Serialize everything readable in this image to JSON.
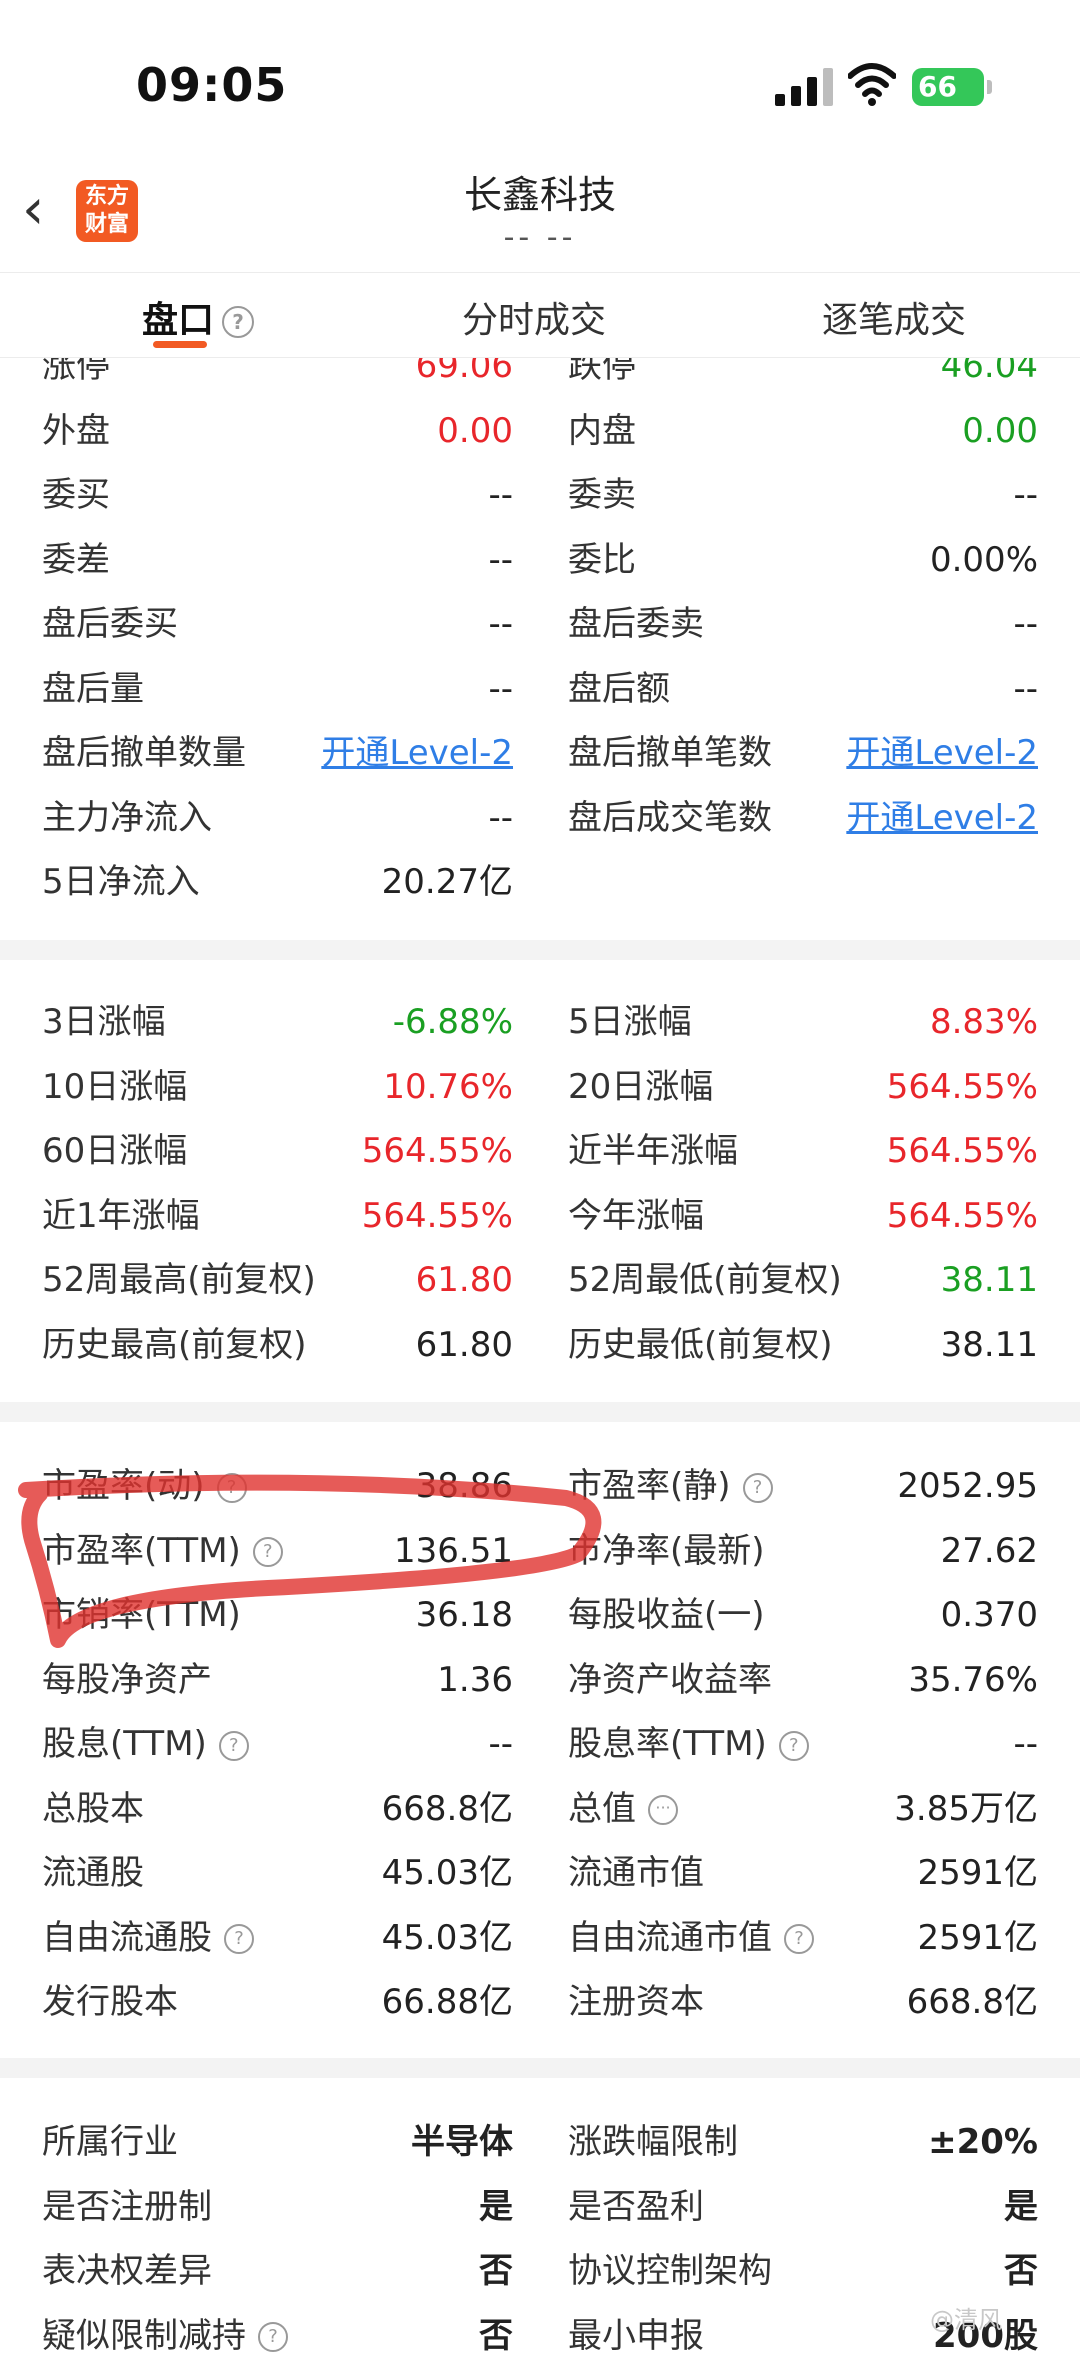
{
  "status_bar": {
    "time": "09:05",
    "battery": "66"
  },
  "header": {
    "title": "长鑫科技",
    "subtitle": "-- --",
    "logo_line1": "东方",
    "logo_line2": "财富"
  },
  "tabs": [
    {
      "label": "盘口",
      "active": true
    },
    {
      "label": "分时成交"
    },
    {
      "label": "逐笔成交"
    }
  ],
  "section1": [
    {
      "l_label": "涨停",
      "l_value": "69.06",
      "l_color": "red",
      "r_label": "跌停",
      "r_value": "46.04",
      "r_color": "green"
    },
    {
      "l_label": "外盘",
      "l_value": "0.00",
      "l_color": "red",
      "r_label": "内盘",
      "r_value": "0.00",
      "r_color": "green"
    },
    {
      "l_label": "委买",
      "l_value": "--",
      "r_label": "委卖",
      "r_value": "--"
    },
    {
      "l_label": "委差",
      "l_value": "--",
      "r_label": "委比",
      "r_value": "0.00%"
    },
    {
      "l_label": "盘后委买",
      "l_value": "--",
      "r_label": "盘后委卖",
      "r_value": "--"
    },
    {
      "l_label": "盘后量",
      "l_value": "--",
      "r_label": "盘后额",
      "r_value": "--"
    },
    {
      "l_label": "盘后撤单数量",
      "l_value": "开通Level-2",
      "l_color": "blue",
      "r_label": "盘后撤单笔数",
      "r_value": "开通Level-2",
      "r_color": "blue"
    },
    {
      "l_label": "主力净流入",
      "l_value": "--",
      "r_label": "盘后成交笔数",
      "r_value": "开通Level-2",
      "r_color": "blue"
    },
    {
      "l_label": "5日净流入",
      "l_value": "20.27亿"
    }
  ],
  "section2": [
    {
      "l_label": "3日涨幅",
      "l_value": "-6.88%",
      "l_color": "green",
      "r_label": "5日涨幅",
      "r_value": "8.83%",
      "r_color": "red"
    },
    {
      "l_label": "10日涨幅",
      "l_value": "10.76%",
      "l_color": "red",
      "r_label": "20日涨幅",
      "r_value": "564.55%",
      "r_color": "red"
    },
    {
      "l_label": "60日涨幅",
      "l_value": "564.55%",
      "l_color": "red",
      "r_label": "近半年涨幅",
      "r_value": "564.55%",
      "r_color": "red"
    },
    {
      "l_label": "近1年涨幅",
      "l_value": "564.55%",
      "l_color": "red",
      "r_label": "今年涨幅",
      "r_value": "564.55%",
      "r_color": "red"
    },
    {
      "l_label": "52周最高(前复权)",
      "l_value": "61.80",
      "l_color": "red",
      "r_label": "52周最低(前复权)",
      "r_value": "38.11",
      "r_color": "green"
    },
    {
      "l_label": "历史最高(前复权)",
      "l_value": "61.80",
      "r_label": "历史最低(前复权)",
      "r_value": "38.11"
    }
  ],
  "section3": [
    {
      "l_label": "市盈率(动)",
      "l_help": true,
      "l_value": "38.86",
      "r_label": "市盈率(静)",
      "r_help": true,
      "r_value": "2052.95"
    },
    {
      "l_label": "市盈率(TTM)",
      "l_help": true,
      "l_value": "136.51",
      "r_label": "市净率(最新)",
      "r_value": "27.62"
    },
    {
      "l_label": "市销率(TTM)",
      "l_value": "36.18",
      "r_label": "每股收益(一)",
      "r_value": "0.370"
    },
    {
      "l_label": "每股净资产",
      "l_value": "1.36",
      "r_label": "净资产收益率",
      "r_value": "35.76%"
    },
    {
      "l_label": "股息(TTM)",
      "l_help": true,
      "l_value": "--",
      "r_label": "股息率(TTM)",
      "r_help": true,
      "r_value": "--"
    },
    {
      "l_label": "总股本",
      "l_value": "668.8亿",
      "r_label": "总值",
      "r_dots": true,
      "r_value": "3.85万亿"
    },
    {
      "l_label": "流通股",
      "l_value": "45.03亿",
      "r_label": "流通市值",
      "r_value": "2591亿"
    },
    {
      "l_label": "自由流通股",
      "l_help": true,
      "l_value": "45.03亿",
      "r_label": "自由流通市值",
      "r_help": true,
      "r_value": "2591亿"
    },
    {
      "l_label": "发行股本",
      "l_value": "66.88亿",
      "r_label": "注册资本",
      "r_value": "668.8亿"
    }
  ],
  "section4": [
    {
      "l_label": "所属行业",
      "l_value": "半导体",
      "l_bold": true,
      "r_label": "涨跌幅限制",
      "r_value": "±20%",
      "r_bold": true
    },
    {
      "l_label": "是否注册制",
      "l_value": "是",
      "l_bold": true,
      "r_label": "是否盈利",
      "r_value": "是",
      "r_bold": true
    },
    {
      "l_label": "表决权差异",
      "l_value": "否",
      "l_bold": true,
      "r_label": "协议控制架构",
      "r_value": "否",
      "r_bold": true
    },
    {
      "l_label": "疑似限制减持",
      "l_help": true,
      "l_value": "否",
      "l_bold": true,
      "r_label": "最小申报",
      "r_value": "200股",
      "r_bold": true
    }
  ],
  "colors": {
    "accent": "#f25a23",
    "up": "#e8262b",
    "down": "#1a9f22",
    "link": "#2f7ee6",
    "annotation": "#e0322e"
  },
  "watermark": "@清风"
}
